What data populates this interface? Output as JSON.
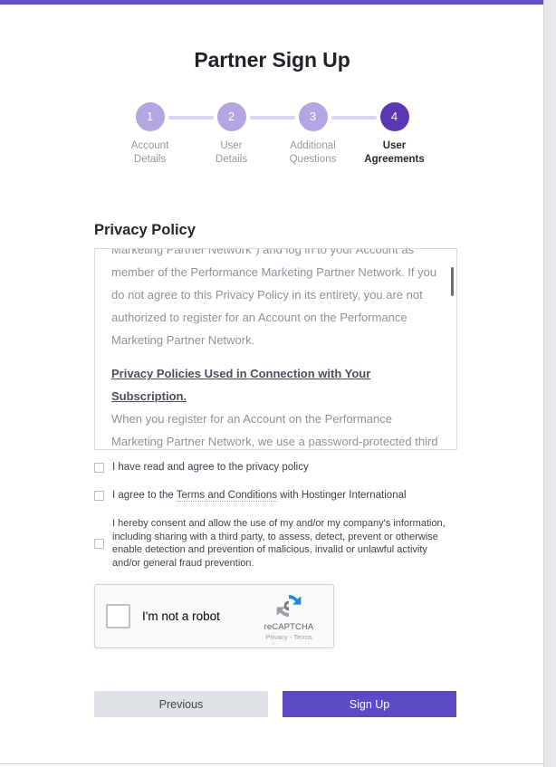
{
  "theme": {
    "accent_bar": "#6350c4",
    "step_inactive": "#b3a6e3",
    "step_active": "#5a37b4",
    "connector": "#ddd5f3",
    "signup_button": "#5b4bc4",
    "previous_button": "#dfe3e7"
  },
  "header": {
    "title": "Partner Sign Up"
  },
  "stepper": {
    "steps": [
      {
        "number": "1",
        "label_line1": "Account",
        "label_line2": "Details",
        "active": false
      },
      {
        "number": "2",
        "label_line1": "User",
        "label_line2": "Details",
        "active": false
      },
      {
        "number": "3",
        "label_line1": "Additional",
        "label_line2": "Questions",
        "active": false
      },
      {
        "number": "4",
        "label_line1": "User",
        "label_line2": "Agreements",
        "active": true
      }
    ]
  },
  "privacy": {
    "section_title": "Privacy Policy",
    "paragraph_1": "Marketing Partner Network\") and log in to your Account as member of the Performance Marketing Partner Network. If you do not agree to this Privacy Policy in its entirety, you are not authorized to register for an Account on the Performance Marketing Partner Network.",
    "subheading": "Privacy Policies Used in Connection with Your Subscription.",
    "paragraph_2": "When you register for an Account on the Performance Marketing Partner Network, we use a password-protected third party portal to store your personal information, and we"
  },
  "agreements": {
    "checkbox_1": "I have read and agree to the privacy policy",
    "checkbox_2_prefix": "I agree to the ",
    "checkbox_2_link": "Terms and Conditions",
    "checkbox_2_suffix": " with Hostinger International",
    "checkbox_3": "I hereby consent and allow the use of my and/or my company's information, including sharing with a third party, to assess, detect, prevent or otherwise enable detection and prevention of malicious, invalid or unlawful activity and/or general fraud prevention."
  },
  "recaptcha": {
    "label": "I'm not a robot",
    "brand": "reCAPTCHA",
    "privacy_link": "Privacy",
    "separator": " - ",
    "terms_link": "Terms"
  },
  "footer": {
    "previous_label": "Previous",
    "signup_label": "Sign Up"
  }
}
